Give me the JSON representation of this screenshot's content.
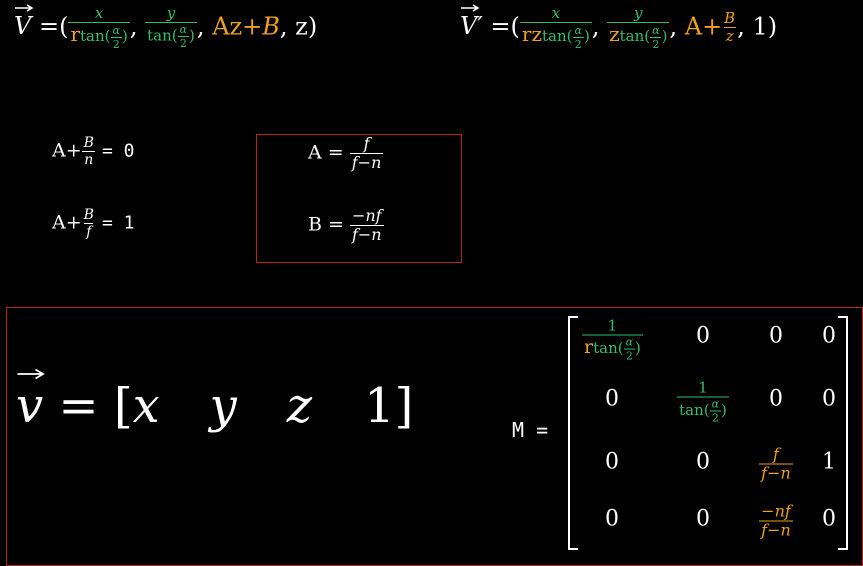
{
  "eq_top_left": {
    "lhs": "V",
    "eq": "=(",
    "x": "x",
    "r": "r",
    "tan": "tan",
    "alpha": "α",
    "two": "2",
    "y": "y",
    "comma": ",",
    "az": "Az",
    "plus": "+",
    "b": "B",
    "z_close": ", z)"
  },
  "eq_top_right": {
    "lhs": "V′",
    "eq": "=(",
    "x": "x",
    "rz": "rz",
    "tan": "tan",
    "alpha": "α",
    "two": "2",
    "y": "y",
    "z": "z",
    "comma": ",",
    "a": "A",
    "plus": "+",
    "b": "B",
    "zd": "z",
    "close": ", 1)"
  },
  "eq_system": {
    "row1": {
      "a": "A+",
      "b": "B",
      "n": "n",
      "rhs": "=  0"
    },
    "row2": {
      "a": "A+",
      "b": "B",
      "f": "f",
      "rhs": "=  1"
    }
  },
  "eq_solution": {
    "a_lhs": "A =",
    "a_num": "f",
    "a_den": "f−n",
    "b_lhs": "B =",
    "b_num": "−nf",
    "b_den": "f−n"
  },
  "vector_v": {
    "lhs": "v",
    "eq": "= [",
    "x": "x",
    "y": "y",
    "z": "z",
    "one": "1",
    "close": "]"
  },
  "matrix_m": {
    "label": "M  =",
    "r1c1_num": "1",
    "r1c1_r": "r",
    "r1c1_tan": "tan",
    "alpha": "α",
    "two": "2",
    "zero": "0",
    "one": "1",
    "r2c2_num": "1",
    "r2c2_tan": "tan",
    "f": "f",
    "fmn": "f−n",
    "mnf": "−nf"
  }
}
